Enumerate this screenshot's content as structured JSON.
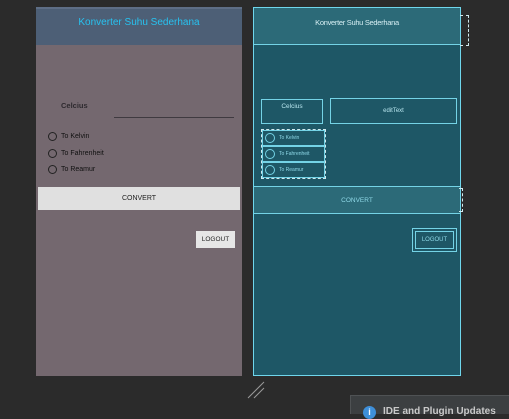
{
  "design": {
    "title": "Konverter Suhu Sederhana",
    "celcius_label": "Celcius",
    "radios": [
      {
        "label": "To Kelvin"
      },
      {
        "label": "To Fahrenheit"
      },
      {
        "label": "To Reamur"
      }
    ],
    "convert_label": "CONVERT",
    "logout_label": "LOGOUT"
  },
  "blueprint": {
    "title": "Konverter Suhu Sederhana",
    "celcius_label": "Celcius",
    "edittext_label": "editText",
    "radios": [
      {
        "label": "To Kelvin"
      },
      {
        "label": "To Fahrenheit"
      },
      {
        "label": "To Reamur"
      }
    ],
    "convert_label": "CONVERT",
    "logout_label": "LOGOUT"
  },
  "notification": {
    "icon": "info-icon",
    "text": "IDE and Plugin Updates"
  },
  "colors": {
    "canvas_bg": "#2b2b2b",
    "design_bg": "#74686f",
    "design_titlebar": "#4d5f76",
    "title_text": "#27c2f0",
    "blueprint_bg": "#1e5766",
    "blueprint_line": "#74d3e6"
  }
}
